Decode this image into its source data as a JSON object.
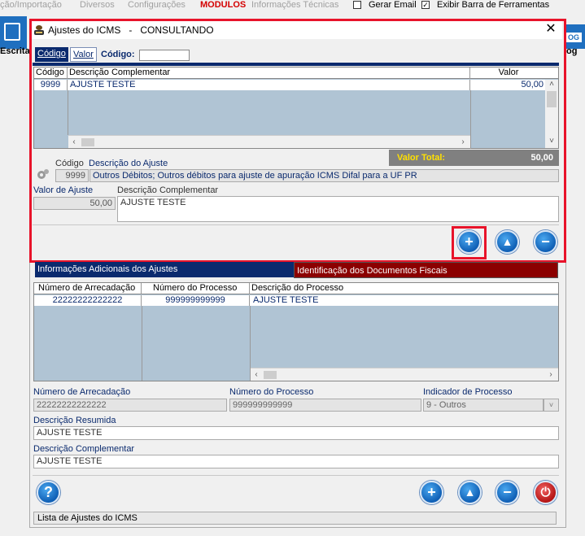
{
  "background_menu": {
    "items": [
      "ção/Importação",
      "Diversos",
      "Configurações",
      "MODULOS",
      "Informações Técnicas"
    ],
    "gerar_email": "Gerar Email",
    "gerar_email_checked": false,
    "exibir_barra": "Exibir Barra de Ferramentas",
    "exibir_barra_checked": true,
    "left_label": "Escrita",
    "right_label": "og",
    "right_badge": "OG"
  },
  "dialog": {
    "title": "Ajustes do ICMS   -   CONSULTANDO",
    "close": "✕"
  },
  "search": {
    "tab_codigo": "Código",
    "tab_valor": "Valor",
    "label": "Código:",
    "value": ""
  },
  "ajustes_grid": {
    "columns": [
      "Código",
      "Descrição Complementar",
      "Valor"
    ],
    "rows": [
      {
        "codigo": "9999",
        "descricao": "AJUSTE TESTE",
        "valor": "50,00"
      }
    ]
  },
  "total": {
    "label": "Valor Total:",
    "value": "50,00"
  },
  "ajuste_detail": {
    "codigo_label": "Código",
    "descricao_label": "Descrição do Ajuste",
    "codigo": "9999",
    "descricao": "Outros Débitos; Outros débitos para ajuste de apuração ICMS Difal para a UF PR",
    "valor_label": "Valor de Ajuste",
    "valor": "50,00",
    "desc_comp_label": "Descrição Complementar",
    "desc_comp": "AJUSTE TESTE"
  },
  "lower_tabs": {
    "info": "Informações Adicionais dos Ajustes",
    "ident": "Identificação dos Documentos Fiscais"
  },
  "info_grid": {
    "columns": [
      "Número de Arrecadação",
      "Número do Processo",
      "Descrição do Processo"
    ],
    "rows": [
      {
        "arrecadacao": "22222222222222",
        "processo": "999999999999",
        "descricao": "AJUSTE TESTE"
      }
    ]
  },
  "info_detail": {
    "arrecadacao_label": "Número de Arrecadação",
    "arrecadacao": "22222222222222",
    "processo_label": "Número do Processo",
    "processo": "999999999999",
    "indicador_label": "Indicador de Processo",
    "indicador": "9 - Outros",
    "desc_resumida_label": "Descrição Resumida",
    "desc_resumida": "AJUSTE TESTE",
    "desc_comp_label": "Descrição Complementar",
    "desc_comp": "AJUSTE TESTE"
  },
  "status": "Lista de Ajustes do ICMS",
  "colors": {
    "accent_navy": "#0a2a6e",
    "highlight_red": "#e8132a",
    "tab_dark_red": "#8b0000",
    "total_yellow": "#ffe000",
    "button_blue": "#0f5fb5",
    "power_red": "#b51515"
  },
  "icons": {
    "help": "question-icon",
    "add": "plus-icon",
    "up": "triangle-up-icon",
    "remove": "minus-icon",
    "power": "power-icon"
  }
}
